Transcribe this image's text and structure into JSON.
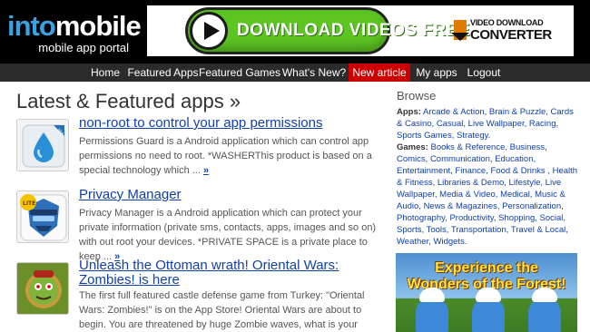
{
  "site": {
    "logo_into": "into",
    "logo_mobile": "mobile",
    "logo_sub": "mobile app portal"
  },
  "ad": {
    "button_text": "DOWNLOAD VIDEOS FREE",
    "brand_top": "VIDEO DOWNLOAD",
    "brand_bottom": "CONVERTER",
    "button_color": "#5cc522"
  },
  "nav": {
    "items": [
      {
        "label": "Home"
      },
      {
        "label": "Featured Apps"
      },
      {
        "label": "Featured Games"
      },
      {
        "label": "What's New?"
      },
      {
        "label": "New article"
      },
      {
        "label": "My apps"
      },
      {
        "label": "Logout"
      }
    ],
    "active_color": "#cc0000"
  },
  "main": {
    "title": "Latest & Featured apps »",
    "more_label": "»",
    "apps": [
      {
        "title": "non-root to control your app permissions",
        "description": "Permissions Guard is a Android application which can control app permissions no need to root. *WASHERThis product is based on a special technology which ...",
        "icon": "water-drop-icon"
      },
      {
        "title": "Privacy Manager",
        "description": "Privacy Manager is a Android application which can protect your private information (private sms, contacts, apps, images and so on) with out root your devices. *PRIVATE SPACE is a private place to keep ...",
        "icon": "spy-icon"
      },
      {
        "title": "Unleash the Ottoman wrath! Oriental Wars: Zombies! is here",
        "description": "The first full featured castle defense game from Turkey: \"Oriental Wars: Zombies!\" is on the App Store! Oriental Wars are about to begin. You are threatened by huge Zombie waves, what is your strategy? Will you accept defeat or ...",
        "icon": "zombie-icon"
      }
    ]
  },
  "sidebar": {
    "browse_title": "Browse",
    "apps_label": "Apps:",
    "apps_links": "Arcade & Action, Brain & Puzzle, Cards & Casino, Casual, Live Wallpaper, Racing, Sports Games, Strategy.",
    "games_label": "Games:",
    "games_links": "Books & Reference, Business, Comics, Communication, Education, Entertainment, Finance, Food & Drinks , Health & Fitness, Libraries & Demo, Lifestyle, Live Wallpaper, Media & Video, Medical, Music & Audio, News & Magazines, Personalization, Photography, Productivity, Shopping, Social, Sports, Tools, Transportation, Travel & Local, Weather, Widgets.",
    "ad_line1": "Experience the",
    "ad_line2": "Wonders of the Forest!"
  }
}
